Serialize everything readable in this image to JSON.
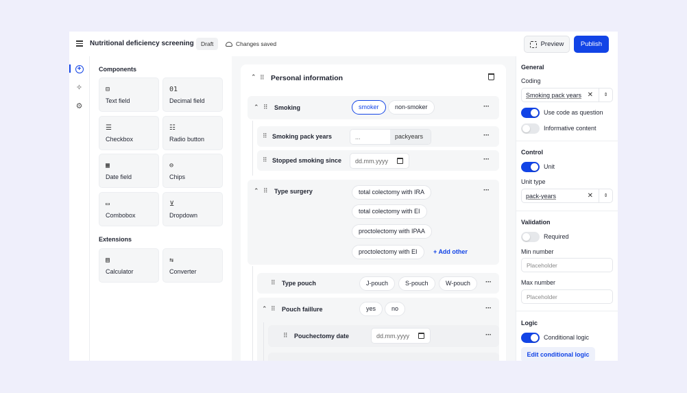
{
  "header": {
    "title": "Nutritional deficiency screening",
    "status_badge": "Draft",
    "save_status": "Changes saved",
    "preview_label": "Preview",
    "publish_label": "Publish"
  },
  "components": {
    "title": "Components",
    "items": [
      {
        "label": "Text field",
        "icon": "text-field-icon",
        "glyph": "⊟"
      },
      {
        "label": "Decimal field",
        "icon": "decimal-icon",
        "glyph": "01"
      },
      {
        "label": "Checkbox",
        "icon": "checkbox-list-icon",
        "glyph": "☰"
      },
      {
        "label": "Radio button",
        "icon": "radio-list-icon",
        "glyph": "☷"
      },
      {
        "label": "Date field",
        "icon": "calendar-icon",
        "glyph": "▦"
      },
      {
        "label": "Chips",
        "icon": "chips-icon",
        "glyph": "⊖"
      },
      {
        "label": "Combobox",
        "icon": "combobox-icon",
        "glyph": "▭"
      },
      {
        "label": "Dropdown",
        "icon": "dropdown-icon",
        "glyph": "⊻"
      }
    ],
    "extensions_title": "Extensions",
    "extensions": [
      {
        "label": "Calculator",
        "icon": "calculator-icon",
        "glyph": "▤"
      },
      {
        "label": "Converter",
        "icon": "converter-icon",
        "glyph": "⇆"
      }
    ]
  },
  "canvas": {
    "section_title": "Personal information",
    "smoking": {
      "label": "Smoking",
      "options": [
        "smoker",
        "non-smoker"
      ],
      "selected": "smoker",
      "children": {
        "pack_years_label": "Smoking pack years",
        "pack_years_placeholder": "...",
        "pack_years_unit": "packyears",
        "stopped_label": "Stopped smoking since",
        "stopped_placeholder": "dd.mm.yyyy"
      }
    },
    "surgery": {
      "label": "Type surgery",
      "options": [
        "total colectomy with IRA",
        "total colectomy with EI",
        "proctolectomy with IPAA",
        "proctolectomy with EI"
      ],
      "add_other": "Add other"
    },
    "pouch": {
      "label": "Type pouch",
      "options": [
        "J-pouch",
        "S-pouch",
        "W-pouch"
      ]
    },
    "failure": {
      "label": "Pouch faillure",
      "options": [
        "yes",
        "no"
      ],
      "pouchectomy_label": "Pouchectomy date",
      "pouchectomy_placeholder": "dd.mm.yyyy"
    }
  },
  "settings": {
    "general": {
      "title": "General",
      "coding_label": "Coding",
      "coding_value": "Smoking pack years",
      "use_code_label": "Use code as question",
      "use_code_on": true,
      "informative_label": "Informative content",
      "informative_on": false
    },
    "control": {
      "title": "Control",
      "unit_label": "Unit",
      "unit_on": true,
      "unit_type_label": "Unit type",
      "unit_type_value": "pack-years"
    },
    "validation": {
      "title": "Validation",
      "required_label": "Required",
      "required_on": false,
      "min_label": "Min number",
      "min_placeholder": "Placeholder",
      "max_label": "Max number",
      "max_placeholder": "Placeholder"
    },
    "logic": {
      "title": "Logic",
      "conditional_label": "Conditional logic",
      "conditional_on": true,
      "edit_label": "Edit conditional logic"
    }
  },
  "colors": {
    "accent": "#1244e6",
    "background": "#efeffb",
    "panel": "#f6f7f8"
  }
}
